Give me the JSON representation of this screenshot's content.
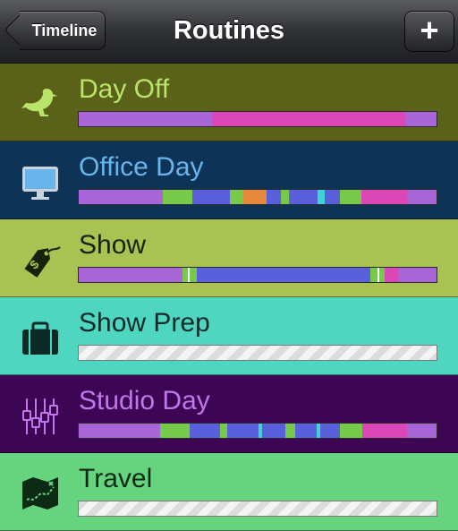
{
  "nav": {
    "back_label": "Timeline",
    "title": "Routines",
    "add_label": "+"
  },
  "colors": {
    "purple": "#a865d8",
    "pink": "#dc47b8",
    "green": "#77c94a",
    "blue": "#5a5fdc",
    "orange": "#e8883a",
    "cyan": "#3ed4d4"
  },
  "routines": [
    {
      "name": "Day Off",
      "icon": "pigeon-icon",
      "bg": "#5a6119",
      "text": "#b9e46a",
      "segments": [
        {
          "c": "#a865d8",
          "w": 150
        },
        {
          "c": "#dc47b8",
          "w": 216
        },
        {
          "c": "#a865d8",
          "w": 34
        }
      ]
    },
    {
      "name": "Office Day",
      "icon": "computer-monitor-icon",
      "bg": "#0d3356",
      "text": "#6ab4ec",
      "segments": [
        {
          "c": "#a865d8",
          "w": 92
        },
        {
          "c": "#77c94a",
          "w": 32
        },
        {
          "c": "#5a5fdc",
          "w": 42
        },
        {
          "c": "#77c94a",
          "w": 14
        },
        {
          "c": "#e8883a",
          "w": 26
        },
        {
          "c": "#5a5fdc",
          "w": 16
        },
        {
          "c": "#77c94a",
          "w": 8
        },
        {
          "c": "#5a5fdc",
          "w": 32
        },
        {
          "c": "#3ed4d4",
          "w": 8
        },
        {
          "c": "#5a5fdc",
          "w": 16
        },
        {
          "c": "#77c94a",
          "w": 24
        },
        {
          "c": "#dc47b8",
          "w": 50
        },
        {
          "c": "#a865d8",
          "w": 32
        }
      ]
    },
    {
      "name": "Show",
      "icon": "price-tag-icon",
      "bg": "#a9c352",
      "text": "#17220a",
      "segments": [
        {
          "c": "#a865d8",
          "w": 116
        },
        {
          "c": "#77c94a",
          "w": 6
        },
        {
          "c": "#ffffff",
          "w": 2
        },
        {
          "c": "#77c94a",
          "w": 8
        },
        {
          "c": "#5a5fdc",
          "w": 194
        },
        {
          "c": "#77c94a",
          "w": 8
        },
        {
          "c": "#ffffff",
          "w": 2
        },
        {
          "c": "#77c94a",
          "w": 6
        },
        {
          "c": "#dc47b8",
          "w": 16
        },
        {
          "c": "#a865d8",
          "w": 42
        }
      ]
    },
    {
      "name": "Show Prep",
      "icon": "briefcase-icon",
      "bg": "#4fd6c0",
      "text": "#0c2a26",
      "segments": []
    },
    {
      "name": "Studio Day",
      "icon": "mixer-sliders-icon",
      "bg": "#3c0654",
      "text": "#c177ea",
      "segments": [
        {
          "c": "#a865d8",
          "w": 90
        },
        {
          "c": "#77c94a",
          "w": 32
        },
        {
          "c": "#5a5fdc",
          "w": 34
        },
        {
          "c": "#77c94a",
          "w": 8
        },
        {
          "c": "#5a5fdc",
          "w": 34
        },
        {
          "c": "#3ed4d4",
          "w": 4
        },
        {
          "c": "#5a5fdc",
          "w": 26
        },
        {
          "c": "#77c94a",
          "w": 10
        },
        {
          "c": "#5a5fdc",
          "w": 24
        },
        {
          "c": "#3ed4d4",
          "w": 4
        },
        {
          "c": "#5a5fdc",
          "w": 22
        },
        {
          "c": "#77c94a",
          "w": 24
        },
        {
          "c": "#dc47b8",
          "w": 50
        },
        {
          "c": "#a865d8",
          "w": 32
        }
      ]
    },
    {
      "name": "Travel",
      "icon": "map-icon",
      "bg": "#66d47e",
      "text": "#0d2a14",
      "segments": []
    }
  ]
}
